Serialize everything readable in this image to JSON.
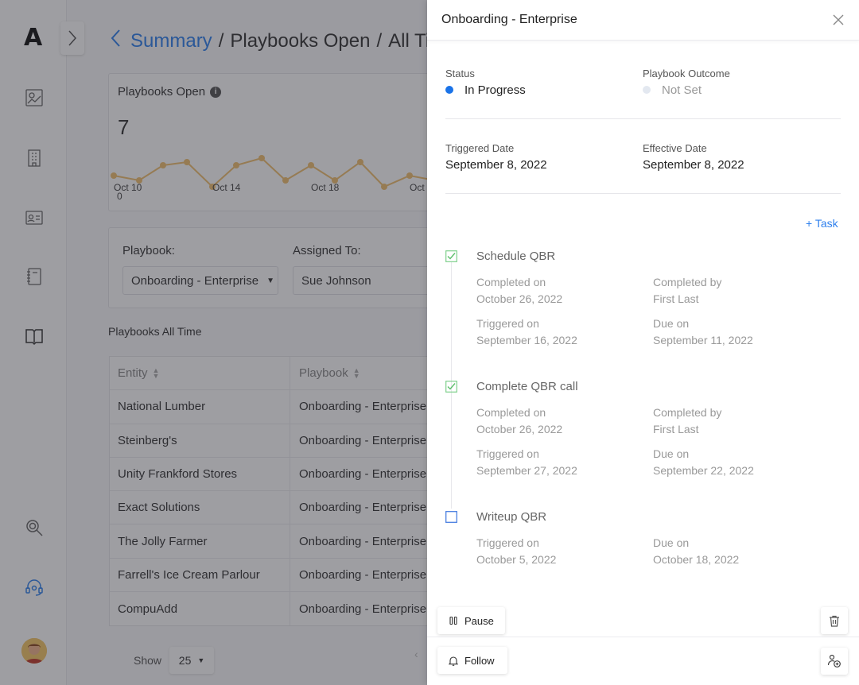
{
  "app": {
    "logo_text": "A",
    "breadcrumb": {
      "back_icon": "chevron-left-icon",
      "link": "Summary",
      "parts": [
        "Playbooks Open",
        "All Ti"
      ]
    },
    "metric": {
      "title": "Playbooks Open",
      "value": "7",
      "axis_zero": "0",
      "ticks": [
        "Oct 10",
        "Oct 14",
        "Oct 18",
        "Oct"
      ]
    },
    "filters": {
      "playbook_label": "Playbook:",
      "playbook_value": "Onboarding - Enterprise",
      "assigned_label": "Assigned To:",
      "assigned_value": "Sue Johnson"
    },
    "table": {
      "section_title": "Playbooks All Time",
      "headers": [
        "Entity",
        "Playbook"
      ],
      "rows": [
        [
          "National Lumber",
          "Onboarding - Enterprise"
        ],
        [
          "Steinberg's",
          "Onboarding - Enterprise"
        ],
        [
          "Unity Frankford Stores",
          "Onboarding - Enterprise"
        ],
        [
          "Exact Solutions",
          "Onboarding - Enterprise"
        ],
        [
          "The Jolly Farmer",
          "Onboarding - Enterprise"
        ],
        [
          "Farrell's Ice Cream Parlour",
          "Onboarding - Enterprise"
        ],
        [
          "CompuAdd",
          "Onboarding - Enterprise"
        ]
      ]
    },
    "pager": {
      "show_label": "Show",
      "page_size": "25"
    }
  },
  "drawer": {
    "title": "Onboarding - Enterprise",
    "status_label": "Status",
    "status_value": "In Progress",
    "status_color": "#1a73e8",
    "outcome_label": "Playbook Outcome",
    "outcome_value": "Not Set",
    "outcome_color": "#e3e8f0",
    "triggered_label": "Triggered Date",
    "triggered_value": "September 8, 2022",
    "effective_label": "Effective Date",
    "effective_value": "September 8, 2022",
    "add_task": "+ Task",
    "tasks": [
      {
        "title": "Schedule QBR",
        "done": true,
        "completed_on_label": "Completed on",
        "completed_on": "October 26, 2022",
        "completed_by_label": "Completed by",
        "completed_by": "First Last",
        "triggered_on_label": "Triggered on",
        "triggered_on": "September 16, 2022",
        "due_on_label": "Due on",
        "due_on": "September 11, 2022"
      },
      {
        "title": "Complete QBR call",
        "done": true,
        "completed_on_label": "Completed on",
        "completed_on": "October 26, 2022",
        "completed_by_label": "Completed by",
        "completed_by": "First Last",
        "triggered_on_label": "Triggered on",
        "triggered_on": "September 27, 2022",
        "due_on_label": "Due on",
        "due_on": "September 22, 2022"
      },
      {
        "title": "Writeup QBR",
        "done": false,
        "triggered_on_label": "Triggered on",
        "triggered_on": "October 5, 2022",
        "due_on_label": "Due on",
        "due_on": "October 18, 2022"
      }
    ],
    "pause_label": "Pause",
    "follow_label": "Follow"
  }
}
